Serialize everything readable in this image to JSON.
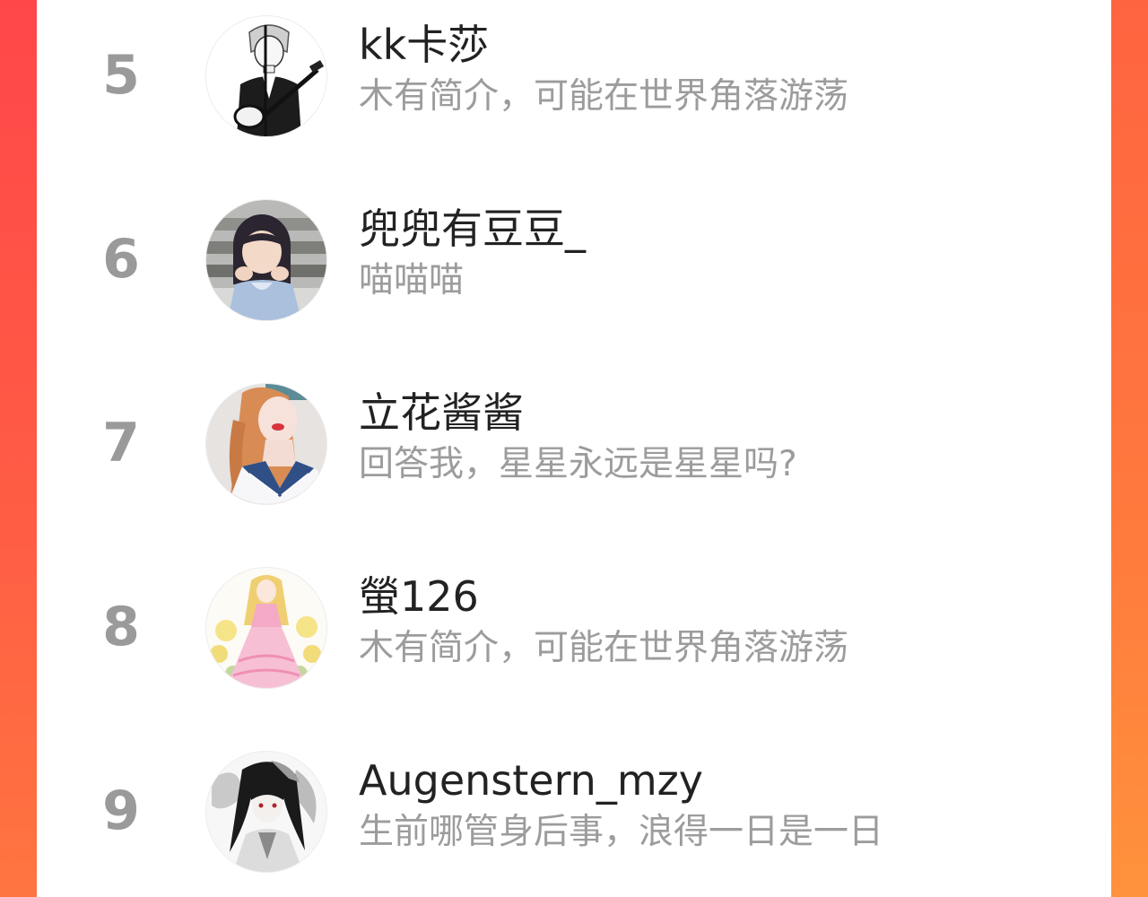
{
  "colors": {
    "accent_gradient_start": "#ff4a48",
    "accent_gradient_end": "#ff8a3c",
    "rank_color": "#9a9a9a",
    "name_color": "#222222",
    "bio_color": "#9c9c9c"
  },
  "ranking": {
    "items": [
      {
        "rank": "5",
        "name": "kk卡莎",
        "bio": "木有简介，可能在世界角落游荡",
        "avatar": "guitarist-sketch-avatar"
      },
      {
        "rank": "6",
        "name": "兜兜有豆豆_",
        "bio": "喵喵喵",
        "avatar": "girl-photo-avatar"
      },
      {
        "rank": "7",
        "name": "立花酱酱",
        "bio": "回答我，星星永远是星星吗?",
        "avatar": "sailor-uniform-avatar"
      },
      {
        "rank": "8",
        "name": "螢126",
        "bio": "木有简介，可能在世界角落游荡",
        "avatar": "princess-illustration-avatar"
      },
      {
        "rank": "9",
        "name": "Augenstern_mzy",
        "bio": "生前哪管身后事，浪得一日是一日",
        "avatar": "ink-anime-avatar"
      }
    ]
  }
}
